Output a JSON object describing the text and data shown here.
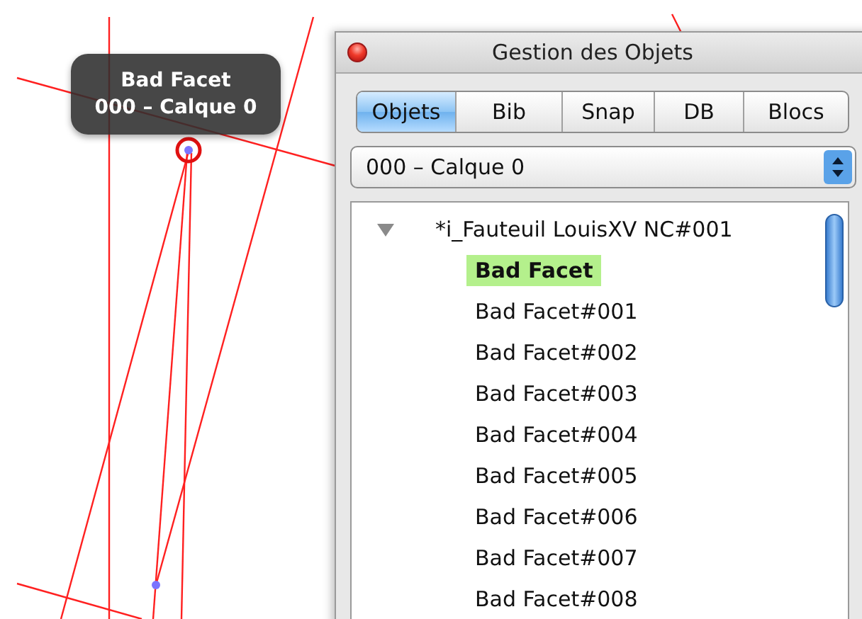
{
  "tooltip": {
    "lines": [
      "Bad Facet",
      "000 – Calque 0"
    ]
  },
  "window": {
    "title": "Gestion des Objets"
  },
  "tabs": [
    {
      "label": "Objets",
      "selected": true
    },
    {
      "label": "Bib",
      "selected": false
    },
    {
      "label": "Snap",
      "selected": false
    },
    {
      "label": "DB",
      "selected": false
    },
    {
      "label": "Blocs",
      "selected": false
    }
  ],
  "layer_popup": {
    "value": "000 – Calque 0"
  },
  "tree": [
    {
      "label": "*i_Fauteuil LouisXV NC#001",
      "expanded": true,
      "children": [
        {
          "label": "Bad Facet",
          "selected": true
        },
        {
          "label": "Bad Facet#001",
          "selected": false
        },
        {
          "label": "Bad Facet#002",
          "selected": false
        },
        {
          "label": "Bad Facet#003",
          "selected": false
        },
        {
          "label": "Bad Facet#004",
          "selected": false
        },
        {
          "label": "Bad Facet#005",
          "selected": false
        },
        {
          "label": "Bad Facet#006",
          "selected": false
        },
        {
          "label": "Bad Facet#007",
          "selected": false
        },
        {
          "label": "Bad Facet#008",
          "selected": false
        }
      ]
    }
  ]
}
